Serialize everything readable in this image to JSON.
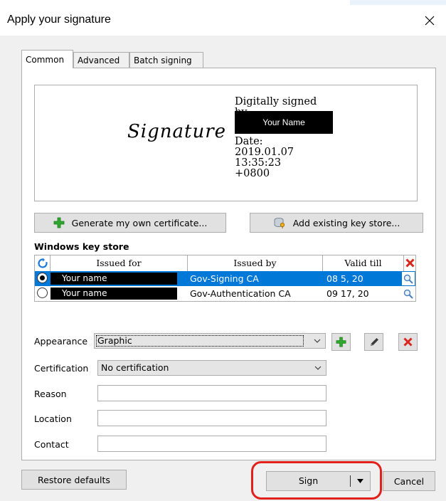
{
  "window": {
    "title": "Apply your signature",
    "close_icon": "×"
  },
  "tabs": [
    {
      "label": "Common",
      "active": true
    },
    {
      "label": "Advanced",
      "active": false
    },
    {
      "label": "Batch signing",
      "active": false
    }
  ],
  "preview": {
    "script_text": "Signature",
    "line1": "Digitally signed",
    "line2": "by",
    "name": "Your Name",
    "date_label": "Date:",
    "date": "2019.01.07",
    "time": "13:35:23",
    "tz": "+0800"
  },
  "buttons": {
    "generate_certificate": "Generate my own certificate...",
    "add_key_store": "Add existing key store...",
    "restore_defaults": "Restore defaults",
    "sign": "Sign",
    "cancel": "Cancel"
  },
  "keystore": {
    "title": "Windows key store",
    "columns": [
      "Issued for",
      "Issued by",
      "Valid till"
    ],
    "rows": [
      {
        "issued_for": "Your name",
        "issued_by": "Gov-Signing CA",
        "valid_till": "08 5, 20",
        "selected": true
      },
      {
        "issued_for": "Your name",
        "issued_by": "Gov-Authentication CA",
        "valid_till": "09 17, 20",
        "selected": false
      }
    ]
  },
  "form": {
    "appearance_label": "Appearance",
    "appearance_value": "Graphic",
    "certification_label": "Certification",
    "certification_value": "No certification",
    "reason_label": "Reason",
    "location_label": "Location",
    "contact_label": "Contact",
    "reason_value": "",
    "location_value": "",
    "contact_value": ""
  },
  "colors": {
    "selection": "#0078d7",
    "highlight_ring": "#e3211c",
    "add_green": "#2ea82e",
    "delete_red": "#d9261c"
  }
}
